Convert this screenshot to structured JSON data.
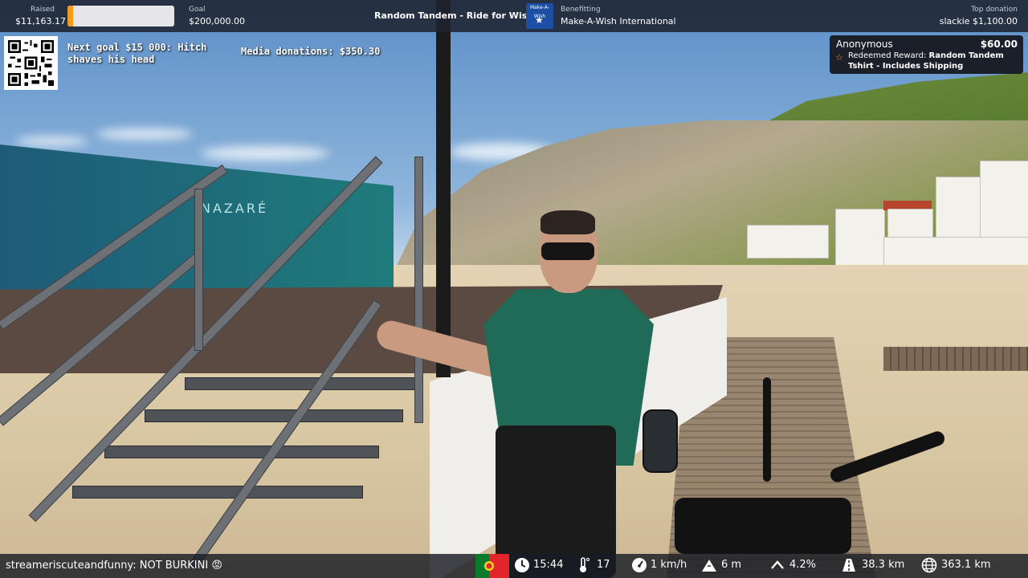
{
  "topbar": {
    "raised_label": "Raised",
    "raised_value": "$11,163.17",
    "progress_fraction": 0.0558,
    "goal_label": "Goal",
    "goal_value": "$200,000.00",
    "title": "Random Tandem - Ride for Wishes",
    "logo_text": "Make-A-Wish",
    "benefitting_label": "Benefitting",
    "benefitting_value": "Make-A-Wish International",
    "top_donation_label": "Top donation",
    "top_donation_value": "slackie $1,100.00"
  },
  "overlay": {
    "next_goal": "Next goal $15 000: Hitch shaves his head",
    "media_donations": "Media donations: $350.30"
  },
  "alert": {
    "name": "Anonymous",
    "amount": "$60.00",
    "line1_prefix": "Redeemed Reward: ",
    "line1_bold": "Random Tandem",
    "line2": "Tshirt - Includes Shipping"
  },
  "scene": {
    "banner_text": "NAZARÉ"
  },
  "bottombar": {
    "chat": "streameriscuteandfunny: NOT BURKINI 😡",
    "time": "15:44",
    "temperature": "17",
    "speed": "1 km/h",
    "altitude": "6 m",
    "grade": "4.2%",
    "distance_today": "38.3 km",
    "distance_total": "363.1 km"
  },
  "colors": {
    "accent": "#f29b1c",
    "topbar_bg": "#1e2330",
    "maw_blue": "#1c4fa3"
  }
}
